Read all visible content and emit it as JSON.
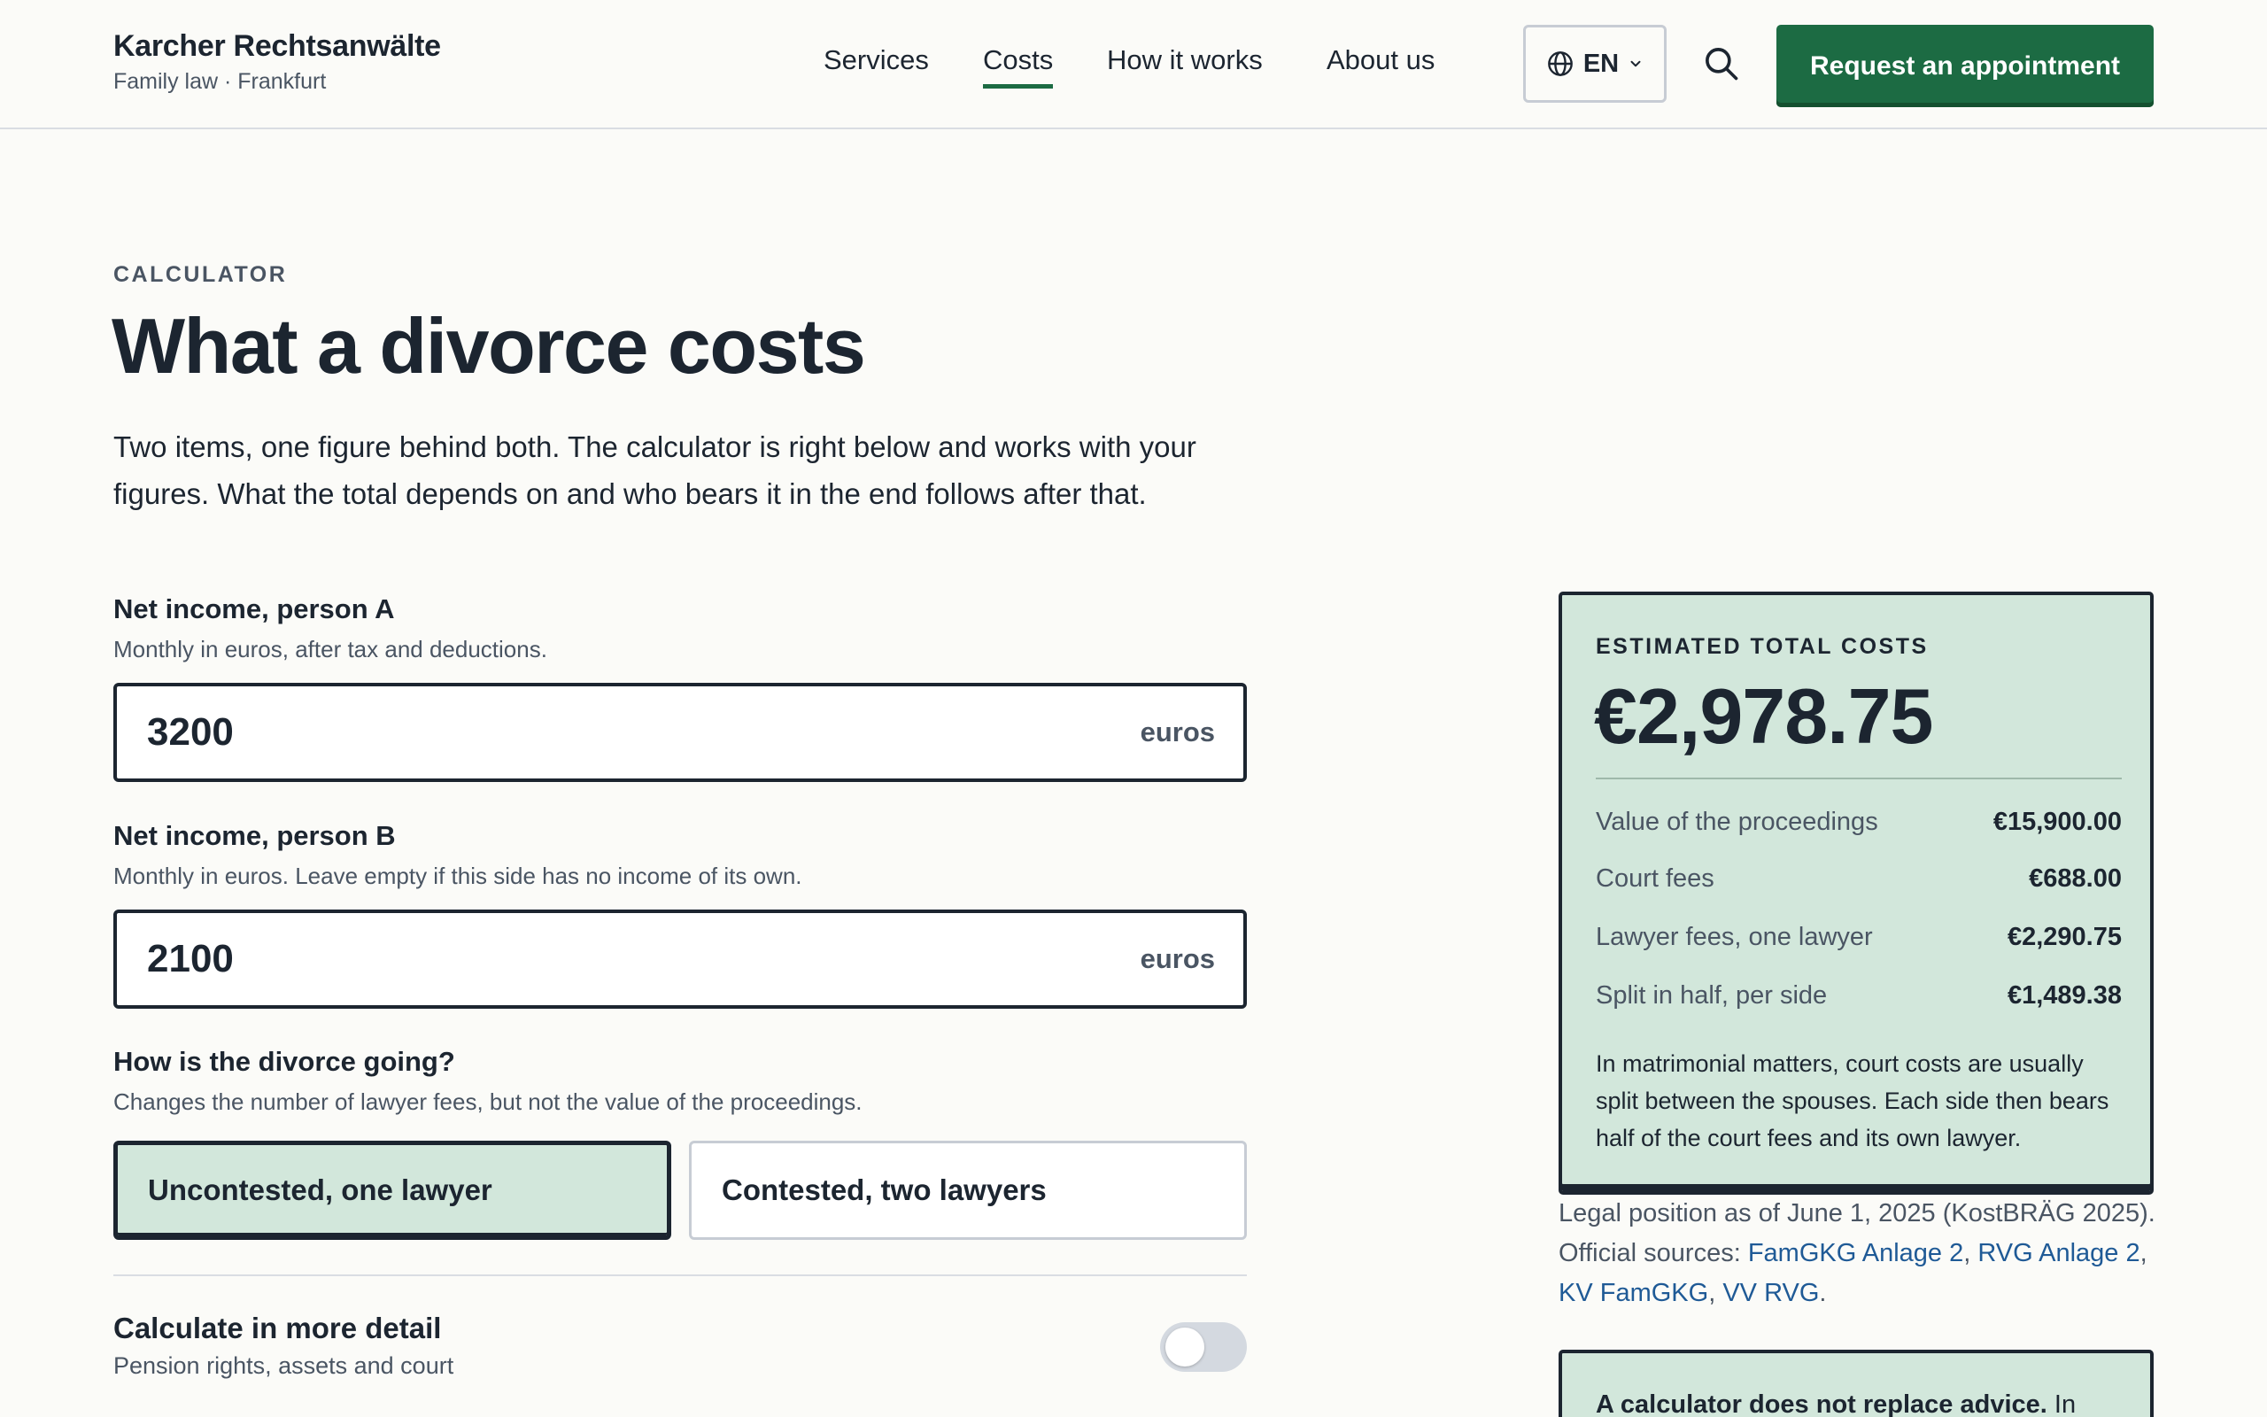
{
  "brand": {
    "name": "Karcher Rechtsanwälte",
    "subtitle": "Family law · Frankfurt"
  },
  "nav": {
    "items": [
      {
        "label": "Services",
        "active": false
      },
      {
        "label": "Costs",
        "active": true
      },
      {
        "label": "How it works",
        "active": false
      },
      {
        "label": "About us",
        "active": false
      }
    ],
    "language": "EN",
    "cta_label": "Request an appointment"
  },
  "page": {
    "eyebrow": "CALCULATOR",
    "title": "What a divorce costs",
    "intro": "Two items, one figure behind both. The calculator is right below and works with your figures. What the total depends on and who bears it in the end follows after that."
  },
  "form": {
    "person_a": {
      "label": "Net income, person A",
      "help": "Monthly in euros, after tax and deductions.",
      "value": "3200",
      "unit": "euros"
    },
    "person_b": {
      "label": "Net income, person B",
      "help": "Monthly in euros. Leave empty if this side has no income of its own.",
      "value": "2100",
      "unit": "euros"
    },
    "mode": {
      "label": "How is the divorce going?",
      "help": "Changes the number of lawyer fees, but not the value of the proceedings.",
      "options": [
        "Uncontested, one lawyer",
        "Contested, two lawyers"
      ],
      "selected": "Uncontested, one lawyer"
    },
    "detail": {
      "label": "Calculate in more detail",
      "help": "Pension rights, assets and court",
      "enabled": false
    }
  },
  "result": {
    "eyebrow": "ESTIMATED TOTAL COSTS",
    "total": "€2,978.75",
    "rows": [
      {
        "label": "Value of the proceedings",
        "value": "€15,900.00"
      },
      {
        "label": "Court fees",
        "value": "€688.00"
      },
      {
        "label": "Lawyer fees, one lawyer",
        "value": "€2,290.75"
      },
      {
        "label": "Split in half, per side",
        "value": "€1,489.38"
      }
    ],
    "note": "In matrimonial matters, court costs are usually split between the spouses. Each side then bears half of the court fees and its own lawyer."
  },
  "legal": {
    "prefix": "Legal position as of June 1, 2025 (KostBRÄG 2025). Official sources: ",
    "links": [
      "FamGKG Anlage 2",
      "RVG Anlage 2",
      "KV FamGKG",
      "VV RVG"
    ],
    "separator": ", ",
    "suffix": "."
  },
  "advice": {
    "bold": "A calculator does not replace advice.",
    "rest": " In"
  },
  "colors": {
    "accent": "#1c6b43",
    "panel": "#d2e7db",
    "ink": "#1c2530",
    "link": "#1f5a96"
  }
}
